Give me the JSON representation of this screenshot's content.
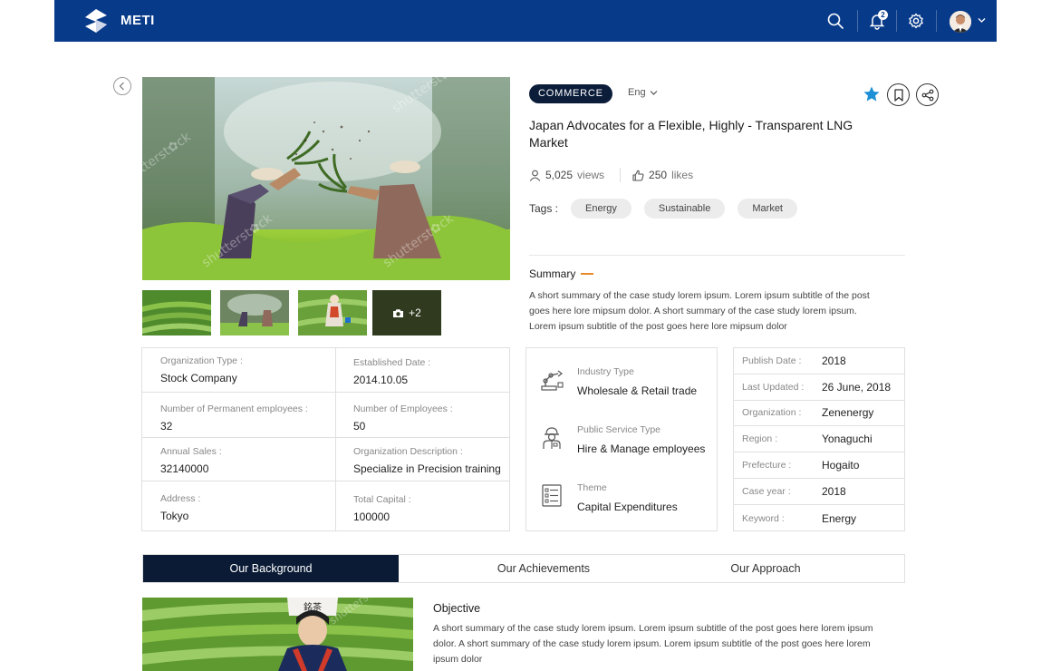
{
  "app": {
    "brand": "METI",
    "notification_count": "2"
  },
  "post": {
    "category": "COMMERCE",
    "language": "Eng",
    "title": "Japan Advocates for a Flexible, Highly - Transparent LNG Market",
    "views": "5,025",
    "views_label": "views",
    "likes": "250",
    "likes_label": "likes",
    "tags_label": "Tags :",
    "tags": [
      "Energy",
      "Sustainable",
      "Market"
    ],
    "summary_title": "Summary",
    "summary_text": "A short summary of the case study lorem ipsum. Lorem ipsum subtitle of the post goes here lore mipsum dolor. A short summary of the case study lorem ipsum. Lorem ipsum subtitle of the post goes here lore mipsum dolor"
  },
  "gallery": {
    "more_label": "+2"
  },
  "organization": [
    {
      "label": "Organization Type :",
      "value": "Stock Company"
    },
    {
      "label": "Established Date :",
      "value": "2014.10.05"
    },
    {
      "label": "Number of Permanent employees :",
      "value": "32"
    },
    {
      "label": "Number of Employees :",
      "value": "50"
    },
    {
      "label": "Annual Sales :",
      "value": "32140000"
    },
    {
      "label": "Organization Description :",
      "value": "Specialize in Precision training"
    },
    {
      "label": "Address :",
      "value": "Tokyo"
    },
    {
      "label": "Total Capital :",
      "value": "100000"
    }
  ],
  "classification": [
    {
      "icon": "robot-arm-icon",
      "label": "Industry Type",
      "value": "Wholesale & Retail trade"
    },
    {
      "icon": "worker-icon",
      "label": "Public Service Type",
      "value": "Hire & Manage employees"
    },
    {
      "icon": "document-list-icon",
      "label": "Theme",
      "value": "Capital Expenditures"
    }
  ],
  "details": [
    {
      "label": "Publish Date :",
      "value": "2018"
    },
    {
      "label": "Last Updated :",
      "value": "26 June, 2018"
    },
    {
      "label": "Organization :",
      "value": "Zenenergy"
    },
    {
      "label": "Region :",
      "value": "Yonaguchi"
    },
    {
      "label": "Prefecture :",
      "value": "Hogaito"
    },
    {
      "label": "Case year :",
      "value": "2018"
    },
    {
      "label": "Keyword :",
      "value": "Energy"
    }
  ],
  "tabs": [
    "Our Background",
    "Our Achievements",
    "Our Approach"
  ],
  "objective": {
    "title": "Objective",
    "text": "A short summary of the case study lorem ipsum. Lorem ipsum subtitle of the post goes here lorem ipsum dolor. A short summary of the case study lorem ipsum. Lorem ipsum subtitle of the post goes here lorem ipsum dolor"
  },
  "colors": {
    "header": "#083a8a",
    "category_pill": "#0c1d3a",
    "active_tab": "#0b1b36",
    "accent_dash": "#e88a2a",
    "star": "#1c8fd6"
  }
}
